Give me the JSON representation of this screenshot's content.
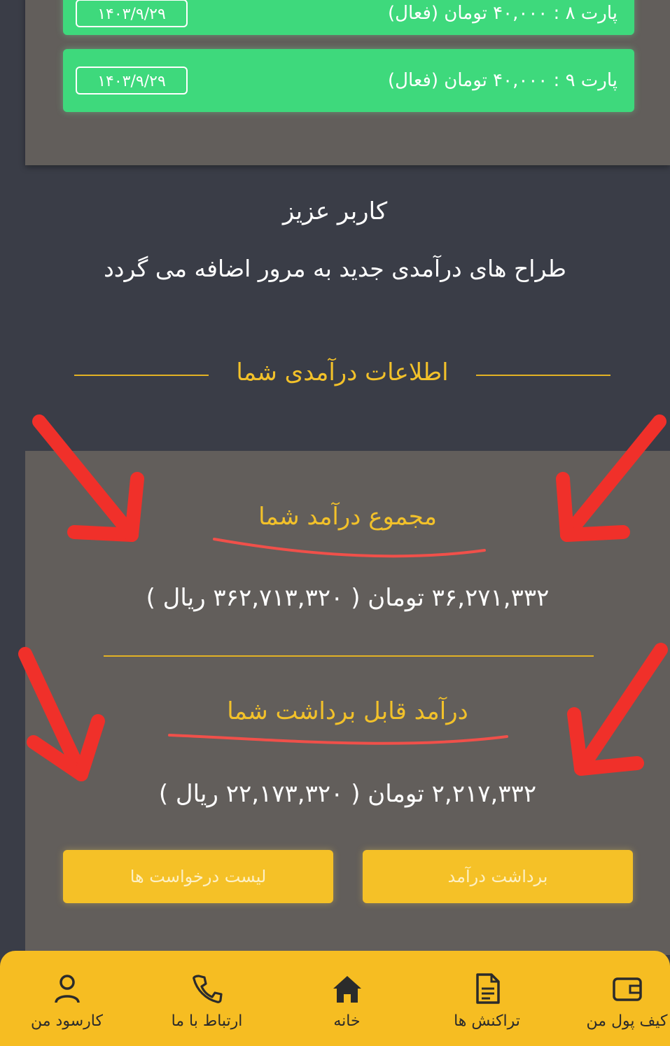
{
  "parts": [
    {
      "label": "پارت ۸ : ۴۰,۰۰۰ تومان (فعال)",
      "date": "۱۴۰۳/۹/۲۹"
    },
    {
      "label": "پارت ۹ : ۴۰,۰۰۰ تومان (فعال)",
      "date": "۱۴۰۳/۹/۲۹"
    }
  ],
  "notice": {
    "greeting": "کاربر عزیز",
    "message": "طراح های درآمدی جدید به مرور اضافه می گردد"
  },
  "income_section": {
    "header": "اطلاعات درآمدی شما",
    "total_title": "مجموع درآمد شما",
    "total_value": "۳۶,۲۷۱,۳۳۲ تومان ( ۳۶۲,۷۱۳,۳۲۰ ریال )",
    "withdrawable_title": "درآمد قابل برداشت شما",
    "withdrawable_value": "۲,۲۱۷,۳۳۲ تومان ( ۲۲,۱۷۳,۳۲۰ ریال )",
    "list_button": "لیست درخواست ها",
    "withdraw_button": "برداشت درآمد"
  },
  "bottom_nav": [
    {
      "label": "کارسود من",
      "icon": "user-icon"
    },
    {
      "label": "ارتباط با ما",
      "icon": "phone-icon"
    },
    {
      "label": "خانه",
      "icon": "home-icon"
    },
    {
      "label": "تراکنش ها",
      "icon": "document-icon"
    },
    {
      "label": "کیف پول من",
      "icon": "wallet-icon"
    }
  ],
  "colors": {
    "background": "#3a3d47",
    "card": "#625e5b",
    "active_green": "#3ed97c",
    "accent_yellow": "#f5c127",
    "annotation_red": "#f0302a"
  }
}
